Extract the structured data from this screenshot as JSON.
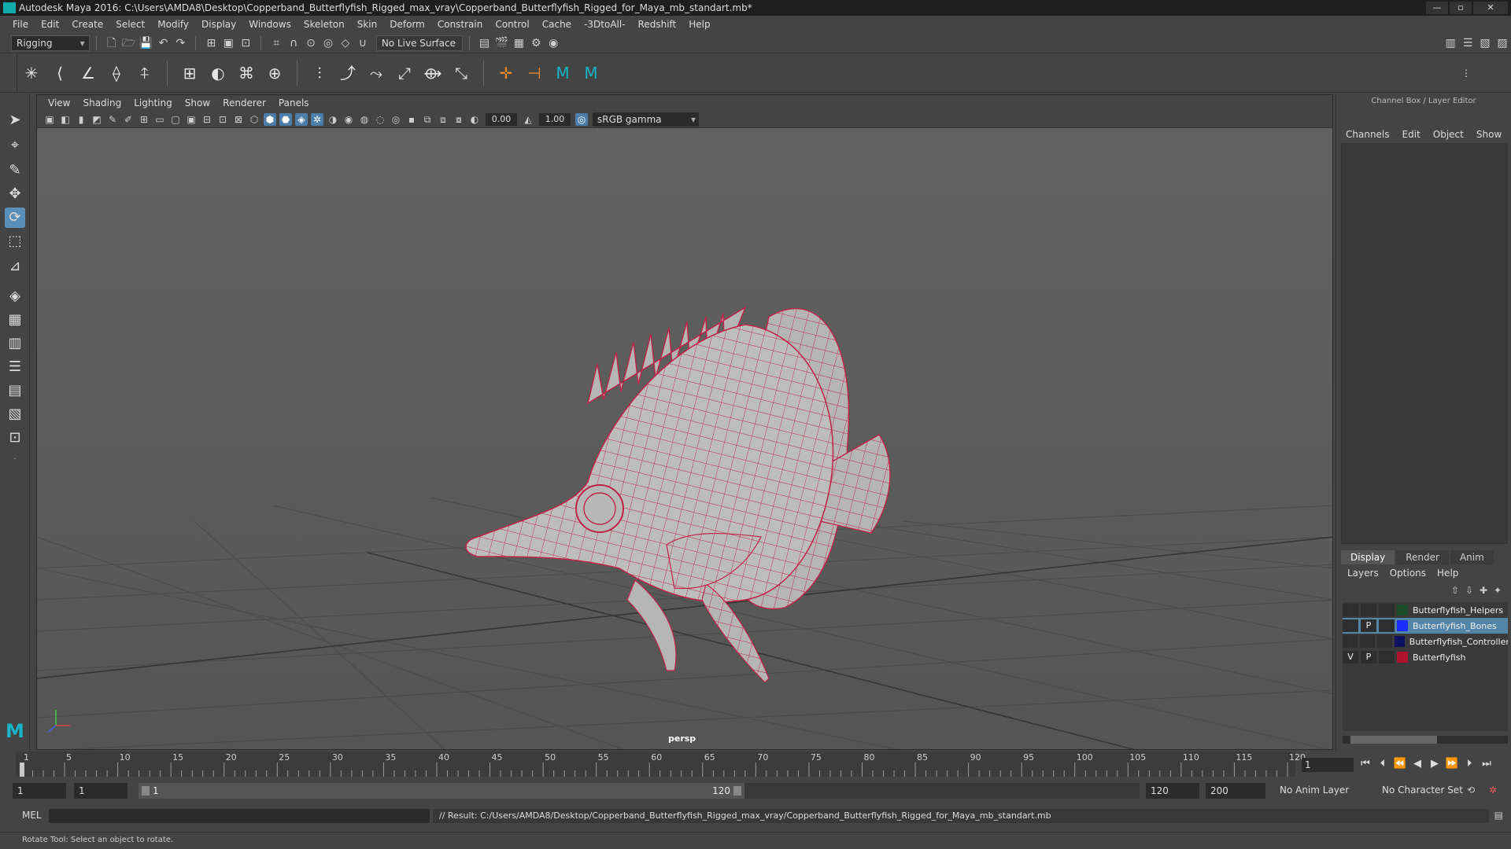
{
  "window": {
    "title": "Autodesk Maya 2016: C:\\Users\\AMDA8\\Desktop\\Copperband_Butterflyfish_Rigged_max_vray\\Copperband_Butterflyfish_Rigged_for_Maya_mb_standart.mb*",
    "minimize": "—",
    "maximize": "▫",
    "close": "✕"
  },
  "menu": [
    "File",
    "Edit",
    "Create",
    "Select",
    "Modify",
    "Display",
    "Windows",
    "Skeleton",
    "Skin",
    "Deform",
    "Constrain",
    "Control",
    "Cache",
    "-3DtoAll-",
    "Redshift",
    "Help"
  ],
  "statusline": {
    "mode": "Rigging",
    "live_surface": "No Live Surface"
  },
  "viewport": {
    "menu": [
      "View",
      "Shading",
      "Lighting",
      "Show",
      "Renderer",
      "Panels"
    ],
    "field_a": "0.00",
    "field_b": "1.00",
    "color_space": "sRGB gamma",
    "camera": "persp"
  },
  "channel_box": {
    "header": "Channel Box / Layer Editor",
    "tabs": [
      "Channels",
      "Edit",
      "Object",
      "Show"
    ]
  },
  "layer_editor": {
    "tabs": [
      "Display",
      "Render",
      "Anim"
    ],
    "menu": [
      "Layers",
      "Options",
      "Help"
    ],
    "layers": [
      {
        "v": "",
        "p": "",
        "name": "Butterflyfish_Helpers",
        "color": "#1c4a2a",
        "selected": false
      },
      {
        "v": "",
        "p": "P",
        "name": "Butterflyfish_Bones",
        "color": "#1a2cff",
        "selected": true
      },
      {
        "v": "",
        "p": "",
        "name": "Butterflyfish_Controllers",
        "color": "#101060",
        "selected": false
      },
      {
        "v": "V",
        "p": "P",
        "name": "Butterflyfish",
        "color": "#b0122e",
        "selected": false
      }
    ]
  },
  "timeline": {
    "tick_labels": [
      "1",
      "5",
      "10",
      "15",
      "20",
      "25",
      "30",
      "35",
      "40",
      "45",
      "50",
      "55",
      "60",
      "65",
      "70",
      "75",
      "80",
      "85",
      "90",
      "95",
      "100",
      "105",
      "110",
      "115",
      "120"
    ],
    "current_frame": "1"
  },
  "range": {
    "start_time": "1",
    "playback_start": "1",
    "bar_start": "1",
    "bar_end": "120",
    "playback_end": "120",
    "end_time": "200",
    "anim_layer": "No Anim Layer",
    "character_set": "No Character Set"
  },
  "command": {
    "label": "MEL",
    "result": "// Result: C:/Users/AMDA8/Desktop/Copperband_Butterflyfish_Rigged_max_vray/Copperband_Butterflyfish_Rigged_for_Maya_mb_standart.mb"
  },
  "help_line": "Rotate Tool: Select an object to rotate.",
  "colors": {
    "accent": "#5285a6",
    "wireframe": "#c0234a",
    "maya_teal": "#19b4c7"
  }
}
